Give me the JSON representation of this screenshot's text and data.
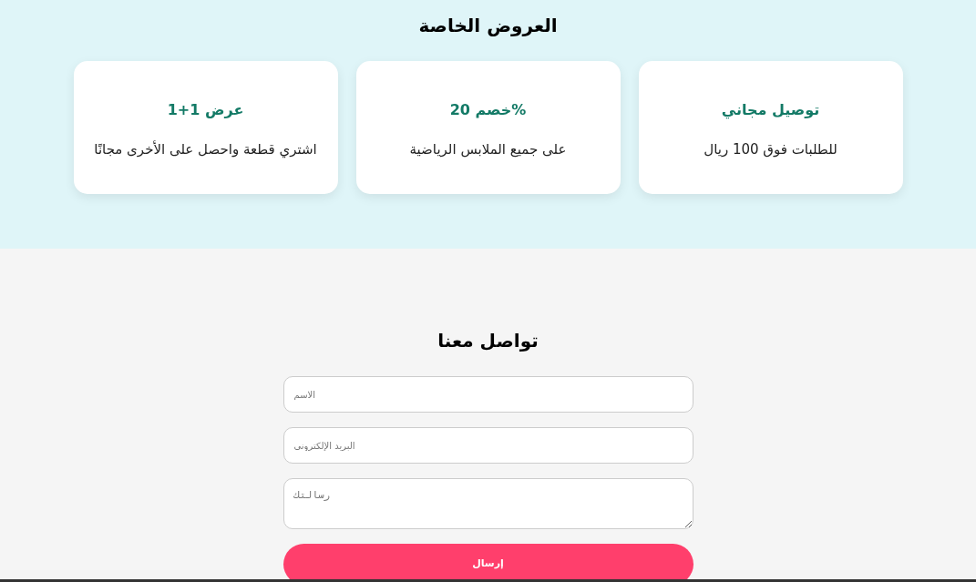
{
  "offers": {
    "title": "العروض الخاصة",
    "cards": [
      {
        "title": "توصيل مجاني",
        "description": "للطلبات فوق 100 ريال"
      },
      {
        "title": "%خصم 20",
        "description": "على جميع الملابس الرياضية"
      },
      {
        "title": "عرض 1+1",
        "description": "اشتري قطعة واحصل على الأخرى مجانًا"
      }
    ]
  },
  "contact": {
    "title": "تواصل معنا",
    "fields": [
      {
        "kind": "input",
        "placeholder": "الاسم"
      },
      {
        "kind": "input",
        "placeholder": "البريد الإلكتروني"
      },
      {
        "kind": "textarea",
        "placeholder": "رسالتك"
      }
    ],
    "submit": "إرسال"
  }
}
